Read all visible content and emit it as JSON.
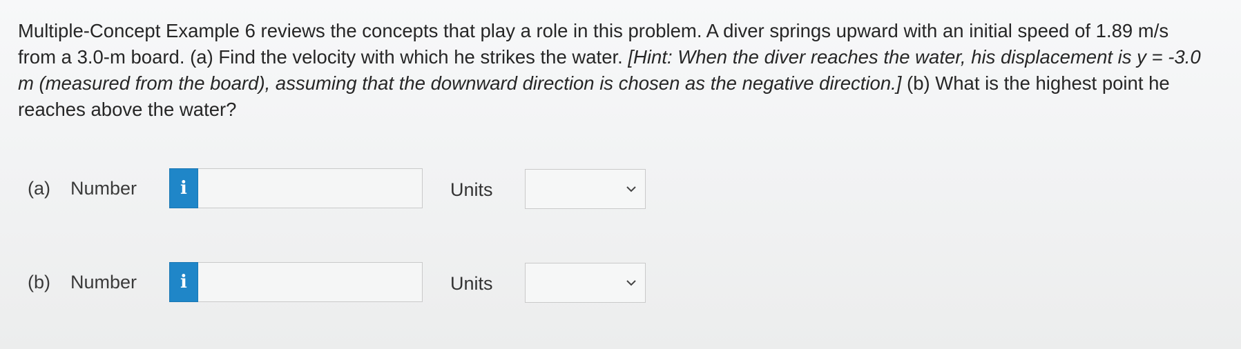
{
  "question": {
    "intro": "Multiple-Concept Example 6 reviews the concepts that play a role in this problem. A diver springs upward with an initial speed of 1.89 m/s from a 3.0-m board. (a) Find the velocity with which he strikes the water. ",
    "hint": "[Hint: When the diver reaches the water, his displacement is y = -3.0 m (measured from the board), assuming that the downward direction is chosen as the negative direction.]",
    "part_b": " (b) What is the highest point he reaches above the water?"
  },
  "parts": [
    {
      "letter": "(a)",
      "number_label": "Number",
      "info_icon": "info-icon",
      "number_value": "",
      "units_label": "Units",
      "units_value": ""
    },
    {
      "letter": "(b)",
      "number_label": "Number",
      "info_icon": "info-icon",
      "number_value": "",
      "units_label": "Units",
      "units_value": ""
    }
  ],
  "colors": {
    "info_button": "#1f86c8",
    "text": "#262626",
    "border": "#c9c9c9"
  }
}
